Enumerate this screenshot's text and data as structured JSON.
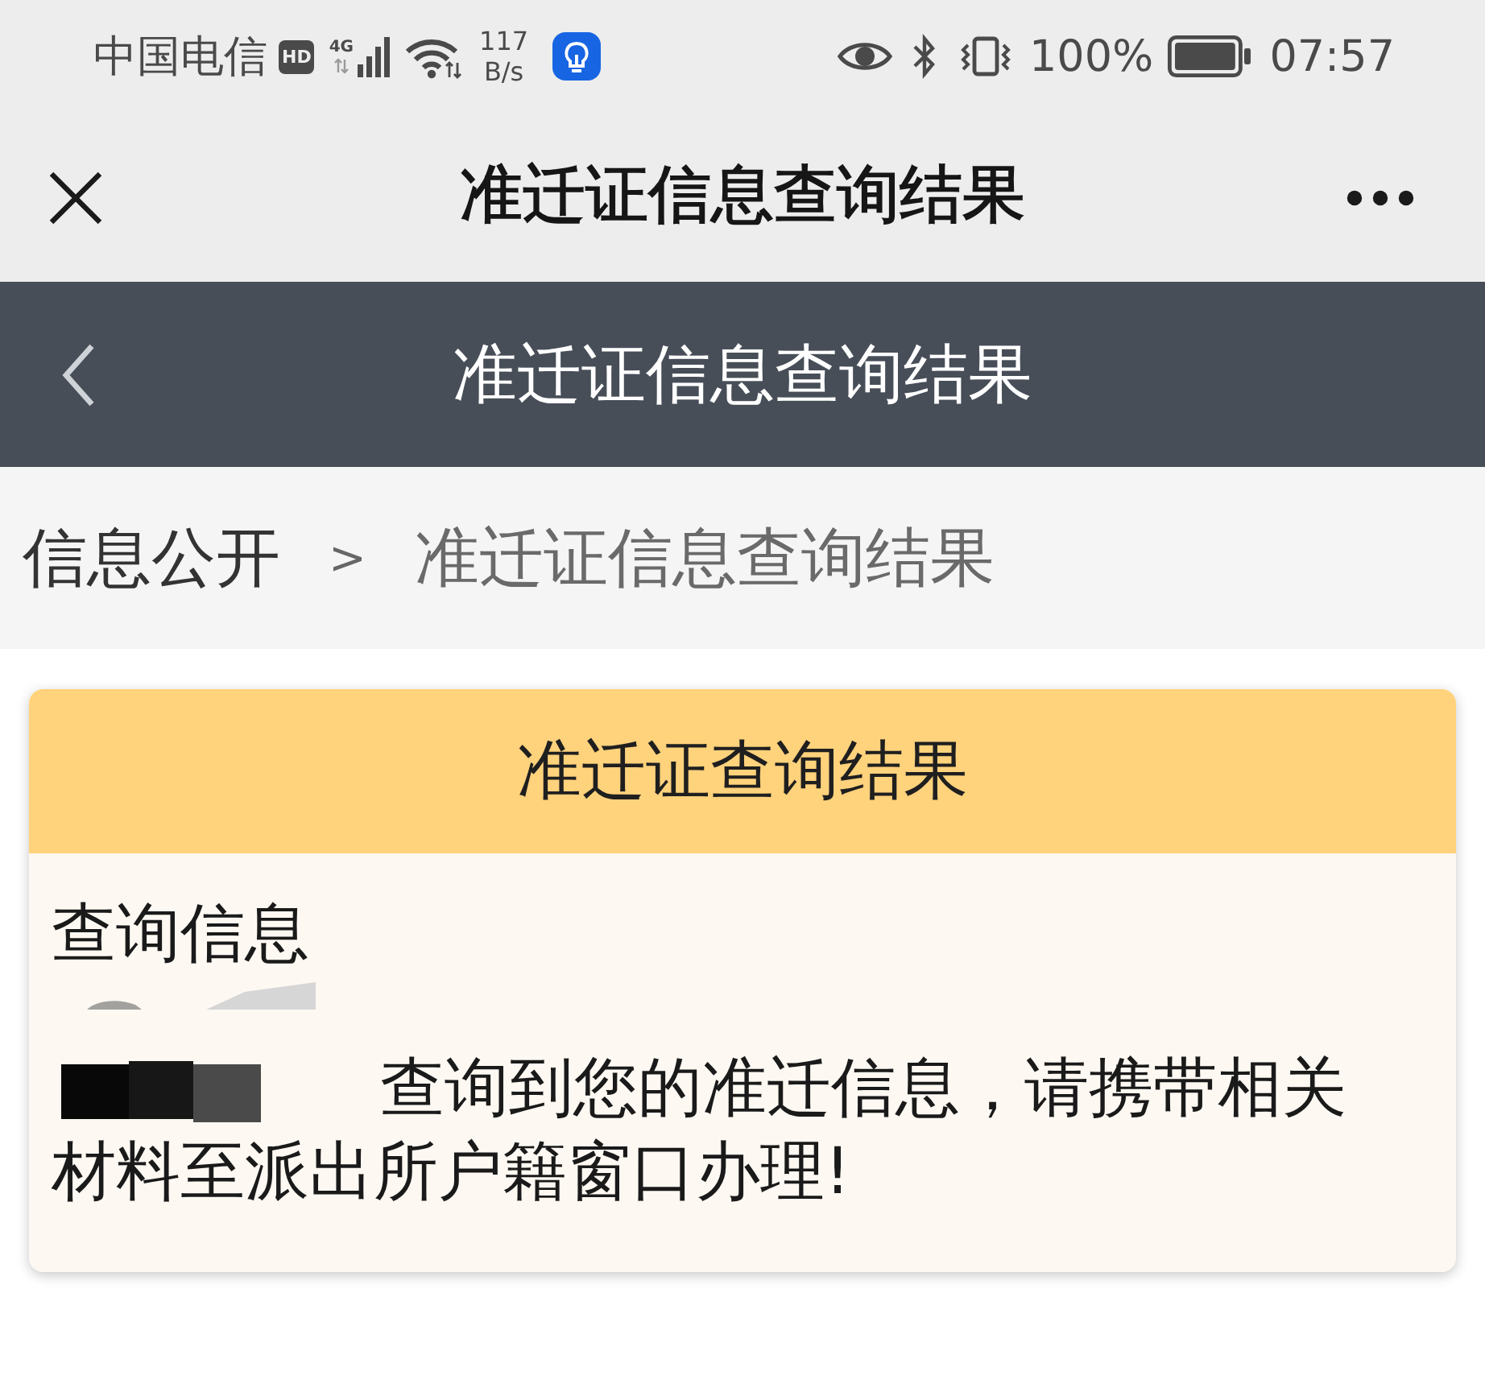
{
  "status_bar": {
    "carrier": "中国电信",
    "hd_badge": "HD",
    "network_type": "4G",
    "speed_value": "117",
    "speed_unit": "B/s",
    "battery_percent": "100%",
    "time": "07:57"
  },
  "nav_bar": {
    "title": "准迁证信息查询结果"
  },
  "page_header": {
    "title": "准迁证信息查询结果"
  },
  "breadcrumb": {
    "items": [
      {
        "label": "信息公开",
        "current": false
      },
      {
        "label": "准迁证信息查询结果",
        "current": true
      }
    ],
    "separator": ">"
  },
  "result_card": {
    "title": "准迁证查询结果",
    "section_label": "查询信息",
    "message_redacted": true,
    "message": "查询到您的准迁信息，请携带相关材料至派出所户籍窗口办理!"
  }
}
